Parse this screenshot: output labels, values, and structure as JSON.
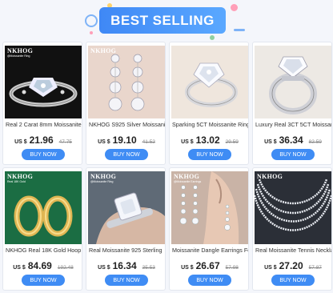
{
  "header": {
    "title": "BEST SELLING"
  },
  "products": [
    {
      "brand": "NKHOG",
      "subbrand": "@Moissanite Ring",
      "title": "Real 2 Carat 8mm Moissanite",
      "currency": "US $",
      "price": "21.96",
      "old_price": "47.75",
      "button": "BUY NOW"
    },
    {
      "brand": "NKHOG",
      "subbrand": "",
      "title": "NKHOG S925 Silver Moissanite",
      "currency": "US $",
      "price": "19.10",
      "old_price": "41.52",
      "button": "BUY NOW"
    },
    {
      "brand": "",
      "subbrand": "",
      "title": "Sparking 5CT Moissanite Rings",
      "currency": "US $",
      "price": "13.02",
      "old_price": "29.59",
      "button": "BUY NOW"
    },
    {
      "brand": "",
      "subbrand": "",
      "title": "Luxury Real 3CT 5CT Moissanite",
      "currency": "US $",
      "price": "36.34",
      "old_price": "82.59",
      "button": "BUY NOW"
    },
    {
      "brand": "NKHOG",
      "subbrand": "Real 18K Gold",
      "title": "NKHOG Real 18K Gold Hoop",
      "currency": "US $",
      "price": "84.69",
      "old_price": "192.48",
      "button": "BUY NOW"
    },
    {
      "brand": "NKHOG",
      "subbrand": "@Moissanite Ring",
      "title": "Real Moissanite 925 Sterling",
      "currency": "US $",
      "price": "16.34",
      "old_price": "35.53",
      "button": "BUY NOW"
    },
    {
      "brand": "NKHOG",
      "subbrand": "@Moissanite Earrings",
      "title": "Moissanite Dangle Earrings For",
      "currency": "US $",
      "price": "26.67",
      "old_price": "57.98",
      "button": "BUY NOW"
    },
    {
      "brand": "NKHOG",
      "subbrand": "VVS Moissanite Tennis Chain",
      "title": "Real Moissanite Tennis Necklace",
      "currency": "US $",
      "price": "27.20",
      "old_price": "57.87",
      "button": "BUY NOW"
    }
  ],
  "icons": [
    "ring-photo",
    "earrings-photo",
    "ring-photo",
    "ring-photo",
    "hoop-earrings-photo",
    "ring-on-hand-photo",
    "dangle-earrings-photo",
    "tennis-necklace-photo"
  ]
}
